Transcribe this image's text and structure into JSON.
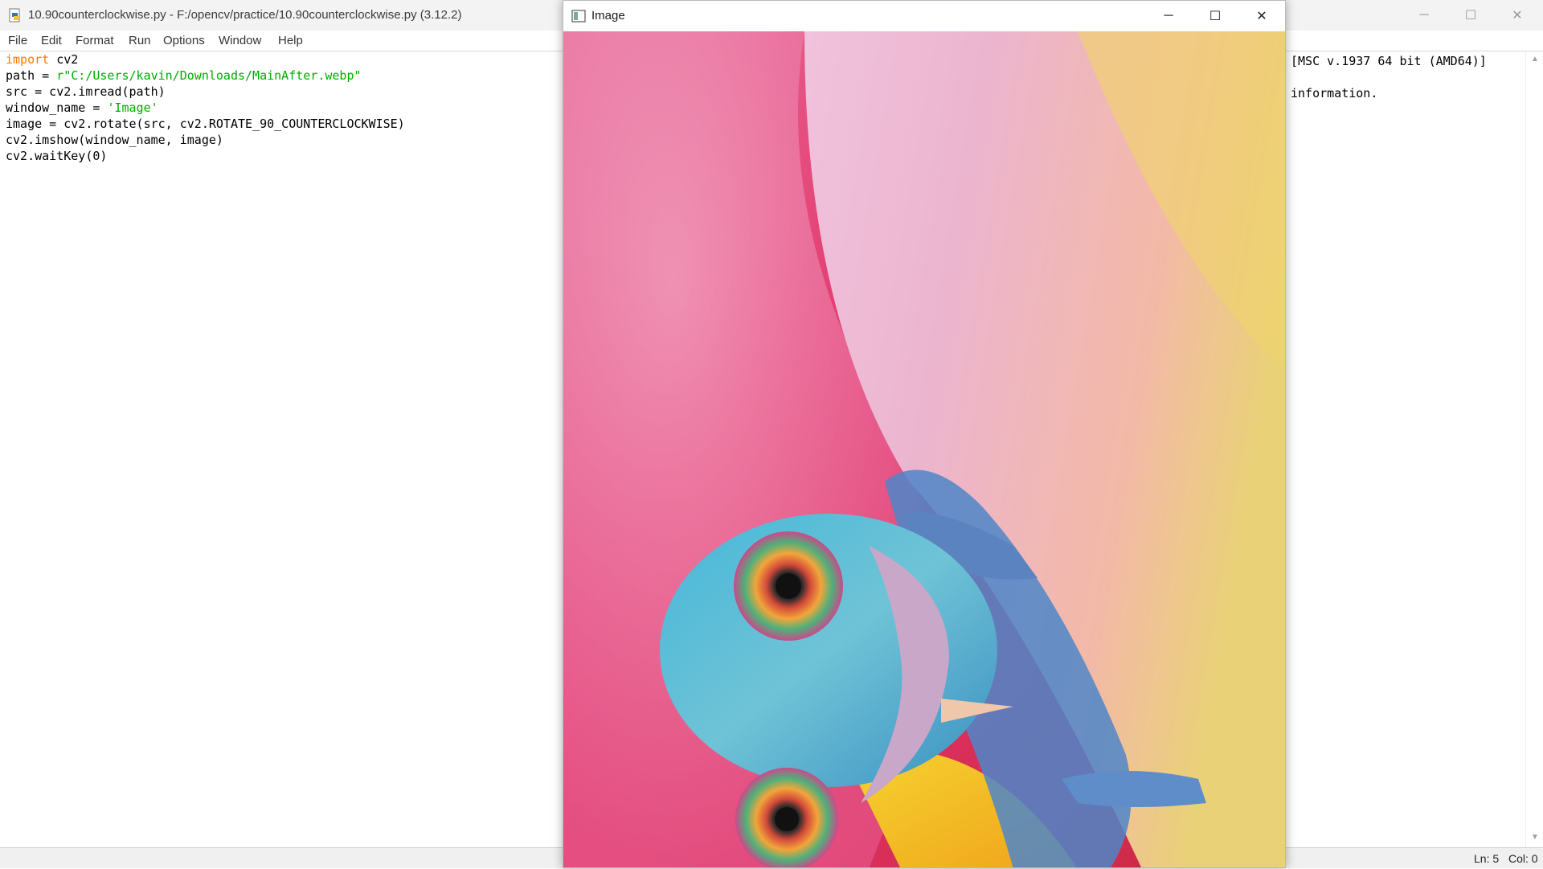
{
  "editor": {
    "title": "10.90counterclockwise.py - F:/opencv/practice/10.90counterclockwise.py (3.12.2)",
    "icon": "python-file-icon",
    "menu": [
      "File",
      "Edit",
      "Format",
      "Run",
      "Options",
      "Window",
      "Help"
    ],
    "code": [
      {
        "kw": "import",
        "rest": " cv2"
      },
      {
        "pre": "path = ",
        "str": "r\"C:/Users/kavin/Downloads/MainAfter.webp\""
      },
      {
        "pre": "src = cv2.imread(path)"
      },
      {
        "pre": "window_name = ",
        "str": "'Image'"
      },
      {
        "pre": "image = cv2.rotate(src, cv2.ROTATE_90_COUNTERCLOCKWISE)"
      },
      {
        "pre": "cv2.imshow(window_name, image)"
      },
      {
        "pre": "cv2.waitKey(0)"
      }
    ],
    "shell_lines": [
      "[MSC v.1937 64 bit (AMD64)]",
      "",
      "information."
    ],
    "status": {
      "ln": "Ln: 5",
      "col": "Col: 0"
    }
  },
  "image_window": {
    "title": "Image",
    "icon": "image-window-icon",
    "photo_description_name": "chameleon-photo"
  },
  "controls": {
    "minimize": "─",
    "maximize": "☐",
    "close": "✕"
  }
}
